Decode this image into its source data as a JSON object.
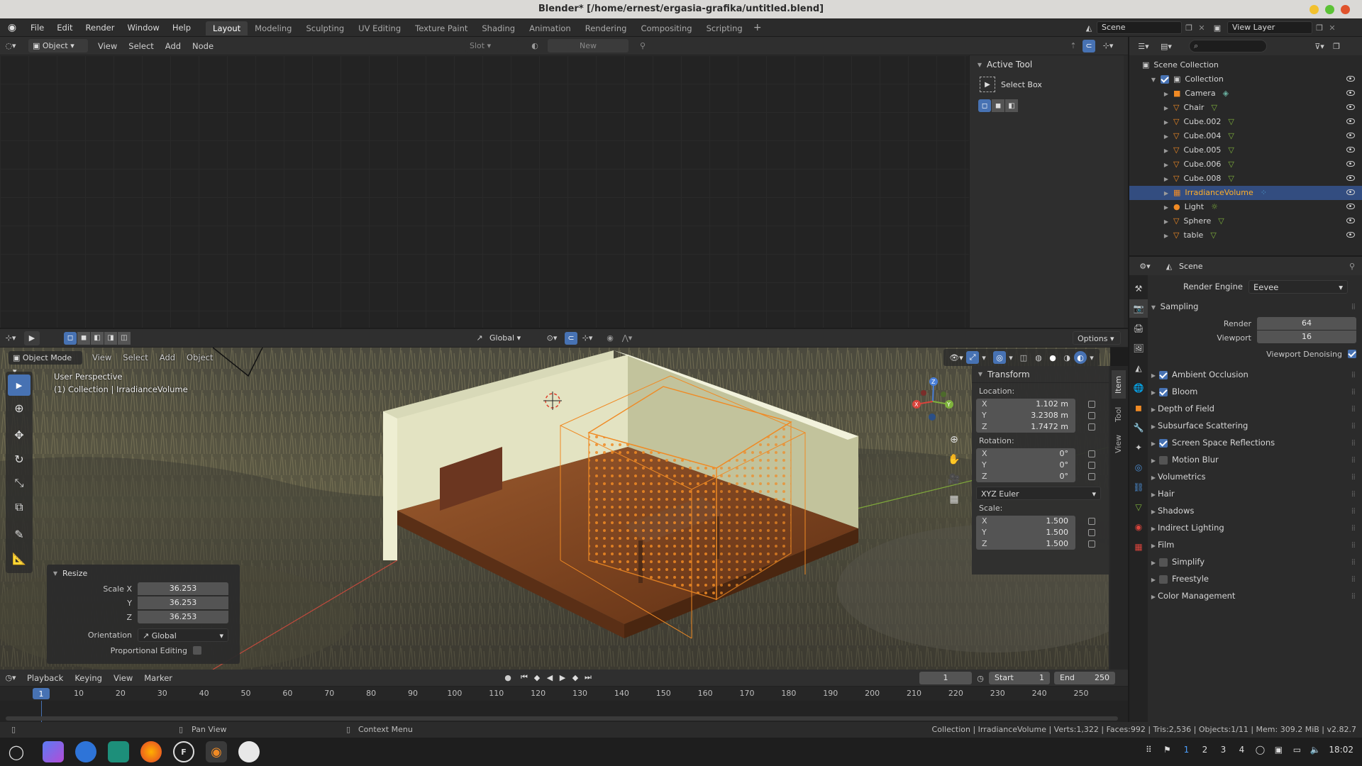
{
  "window": {
    "title": "Blender* [/home/ernest/ergasia-grafika/untitled.blend]"
  },
  "menus": [
    "File",
    "Edit",
    "Render",
    "Window",
    "Help"
  ],
  "workspaces": [
    "Layout",
    "Modeling",
    "Sculpting",
    "UV Editing",
    "Texture Paint",
    "Shading",
    "Animation",
    "Rendering",
    "Compositing",
    "Scripting"
  ],
  "scene_selector": {
    "value": "Scene"
  },
  "view_layer": {
    "value": "View Layer"
  },
  "node_editor": {
    "header": {
      "object_dropdown": "Object",
      "menus": [
        "View",
        "Select",
        "Add",
        "Node"
      ],
      "slot": "Slot",
      "new_label": "New"
    },
    "active_tool": {
      "title": "Active Tool",
      "tool": "Select Box"
    }
  },
  "viewport": {
    "mode": "Object Mode",
    "menus": [
      "View",
      "Select",
      "Add",
      "Object"
    ],
    "orientation": "Global",
    "options": "Options",
    "overlay_title": "User Perspective",
    "overlay_subtitle": "(1) Collection | IrradianceVolume"
  },
  "transform": {
    "title": "Transform",
    "location_label": "Location:",
    "location": [
      {
        "axis": "X",
        "value": "1.102 m"
      },
      {
        "axis": "Y",
        "value": "3.2308 m"
      },
      {
        "axis": "Z",
        "value": "1.7472 m"
      }
    ],
    "rotation_label": "Rotation:",
    "rotation": [
      {
        "axis": "X",
        "value": "0°"
      },
      {
        "axis": "Y",
        "value": "0°"
      },
      {
        "axis": "Z",
        "value": "0°"
      }
    ],
    "rotation_mode": "XYZ Euler",
    "scale_label": "Scale:",
    "scale": [
      {
        "axis": "X",
        "value": "1.500"
      },
      {
        "axis": "Y",
        "value": "1.500"
      },
      {
        "axis": "Z",
        "value": "1.500"
      }
    ]
  },
  "sidebar_tabs": [
    "Item",
    "Tool",
    "View"
  ],
  "resize_panel": {
    "title": "Resize",
    "fields": [
      {
        "label": "Scale X",
        "value": "36.253"
      },
      {
        "label": "Y",
        "value": "36.253"
      },
      {
        "label": "Z",
        "value": "36.253"
      }
    ],
    "orientation_label": "Orientation",
    "orientation_value": "Global",
    "proportional_label": "Proportional Editing"
  },
  "outliner": {
    "root": "Scene Collection",
    "collection": "Collection",
    "items": [
      "Camera",
      "Chair",
      "Cube.002",
      "Cube.004",
      "Cube.005",
      "Cube.006",
      "Cube.008",
      "IrradianceVolume",
      "Light",
      "Sphere",
      "table"
    ],
    "selected": "IrradianceVolume"
  },
  "properties": {
    "context": "Scene",
    "render_engine_label": "Render Engine",
    "render_engine": "Eevee",
    "sampling": {
      "title": "Sampling",
      "render_label": "Render",
      "render": "64",
      "viewport_label": "Viewport",
      "viewport": "16",
      "denoise_label": "Viewport Denoising"
    },
    "sections": [
      {
        "label": "Ambient Occlusion",
        "checkbox": true,
        "checked": true
      },
      {
        "label": "Bloom",
        "checkbox": true,
        "checked": true
      },
      {
        "label": "Depth of Field",
        "checkbox": false
      },
      {
        "label": "Subsurface Scattering",
        "checkbox": false
      },
      {
        "label": "Screen Space Reflections",
        "checkbox": true,
        "checked": true
      },
      {
        "label": "Motion Blur",
        "checkbox": true,
        "checked": false
      },
      {
        "label": "Volumetrics",
        "checkbox": false
      },
      {
        "label": "Hair",
        "checkbox": false
      },
      {
        "label": "Shadows",
        "checkbox": false
      },
      {
        "label": "Indirect Lighting",
        "checkbox": false
      },
      {
        "label": "Film",
        "checkbox": false
      },
      {
        "label": "Simplify",
        "checkbox": true,
        "checked": false
      },
      {
        "label": "Freestyle",
        "checkbox": true,
        "checked": false
      },
      {
        "label": "Color Management",
        "checkbox": false
      }
    ]
  },
  "timeline": {
    "menus": [
      "Playback",
      "Keying",
      "View",
      "Marker"
    ],
    "current_frame": "1",
    "start_label": "Start",
    "start": "1",
    "end_label": "End",
    "end": "250",
    "ticks": [
      "10",
      "20",
      "30",
      "40",
      "50",
      "60",
      "70",
      "80",
      "90",
      "100",
      "110",
      "120",
      "130",
      "140",
      "150",
      "160",
      "170",
      "180",
      "190",
      "200",
      "210",
      "220",
      "230",
      "240",
      "250"
    ]
  },
  "statusbar": {
    "left": "Pan View",
    "middle": "Context Menu",
    "right": "Collection | IrradianceVolume | Verts:1,322 | Faces:992 | Tris:2,536 | Objects:1/11 | Mem: 309.2 MiB | v2.82.7"
  },
  "taskbar": {
    "workspaces": [
      "1",
      "2",
      "3",
      "4"
    ],
    "clock": "18:02"
  },
  "colors": {
    "accent": "#4772b3",
    "selection": "#334d80",
    "active_orange": "#f08a24"
  }
}
